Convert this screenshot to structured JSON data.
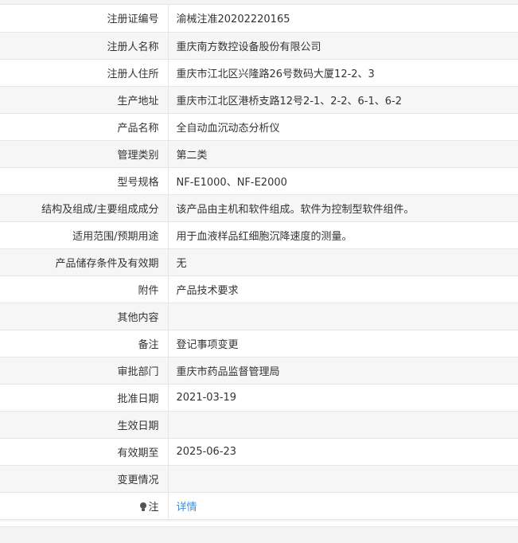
{
  "rows": [
    {
      "label": "注册证编号",
      "value": "渝械注准20202220165"
    },
    {
      "label": "注册人名称",
      "value": "重庆南方数控设备股份有限公司"
    },
    {
      "label": "注册人住所",
      "value": "重庆市江北区兴隆路26号数码大厦12-2、3"
    },
    {
      "label": "生产地址",
      "value": "重庆市江北区港桥支路12号2-1、2-2、6-1、6-2"
    },
    {
      "label": "产品名称",
      "value": "全自动血沉动态分析仪"
    },
    {
      "label": "管理类别",
      "value": "第二类"
    },
    {
      "label": "型号规格",
      "value": "NF-E1000、NF-E2000"
    },
    {
      "label": "结构及组成/主要组成成分",
      "value": "该产品由主机和软件组成。软件为控制型软件组件。"
    },
    {
      "label": "适用范围/预期用途",
      "value": "用于血液样品红细胞沉降速度的测量。"
    },
    {
      "label": "产品储存条件及有效期",
      "value": "无"
    },
    {
      "label": "附件",
      "value": "产品技术要求"
    },
    {
      "label": "其他内容",
      "value": ""
    },
    {
      "label": "备注",
      "value": "登记事项变更"
    },
    {
      "label": "审批部门",
      "value": "重庆市药品监督管理局"
    },
    {
      "label": "批准日期",
      "value": "2021-03-19"
    },
    {
      "label": "生效日期",
      "value": ""
    },
    {
      "label": "有效期至",
      "value": "2025-06-23"
    },
    {
      "label": "变更情况",
      "value": ""
    }
  ],
  "note_row": {
    "icon": "lightbulb-icon",
    "label": "注",
    "link_label": "详情"
  },
  "colors": {
    "link": "#3b8fd6",
    "row_alt_bg": "#f6f6f6",
    "border": "#e6e6e6",
    "text": "#333333"
  }
}
